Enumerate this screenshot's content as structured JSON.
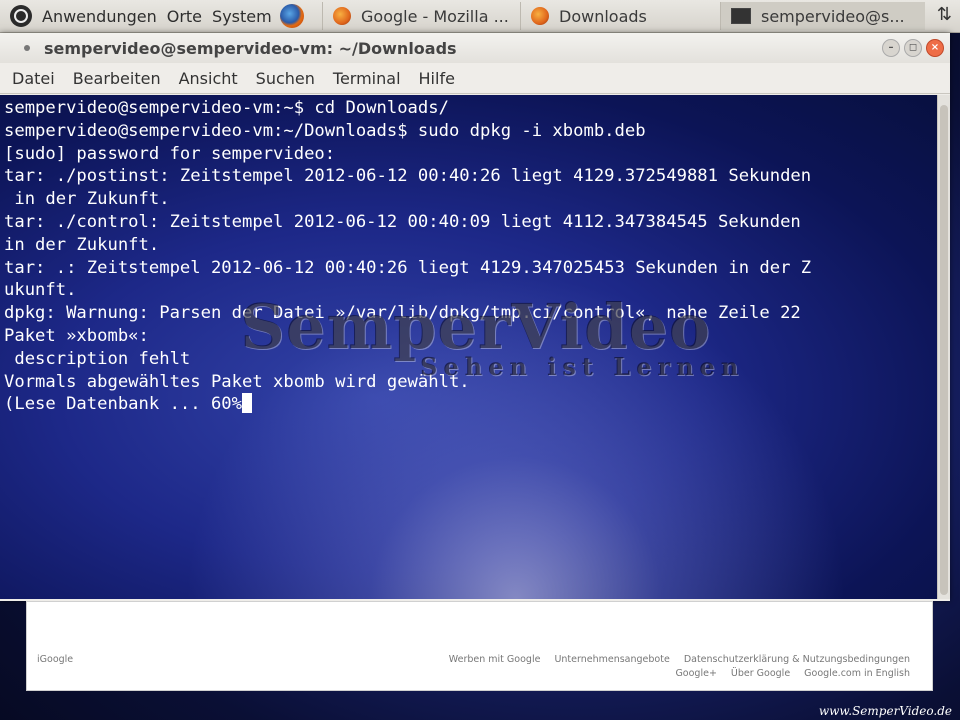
{
  "top_panel": {
    "menus": [
      "Anwendungen",
      "Orte",
      "System"
    ],
    "tasks": [
      "Google - Mozilla ...",
      "Downloads",
      "sempervideo@s..."
    ],
    "arrows_glyph": "⇅"
  },
  "window": {
    "title": "sempervideo@sempervideo-vm: ~/Downloads",
    "menubar": [
      "Datei",
      "Bearbeiten",
      "Ansicht",
      "Suchen",
      "Terminal",
      "Hilfe"
    ],
    "buttons": {
      "minimize": "–",
      "maximize": "◻",
      "close": "×"
    }
  },
  "terminal": {
    "lines": [
      "sempervideo@sempervideo-vm:~$ cd Downloads/",
      "sempervideo@sempervideo-vm:~/Downloads$ sudo dpkg -i xbomb.deb",
      "[sudo] password for sempervideo:",
      "tar: ./postinst: Zeitstempel 2012-06-12 00:40:26 liegt 4129.372549881 Sekunden",
      " in der Zukunft.",
      "tar: ./control: Zeitstempel 2012-06-12 00:40:09 liegt 4112.347384545 Sekunden",
      "in der Zukunft.",
      "tar: .: Zeitstempel 2012-06-12 00:40:26 liegt 4129.347025453 Sekunden in der Z",
      "ukunft.",
      "dpkg: Warnung: Parsen der Datei »/var/lib/dpkg/tmp.ci/control«, nahe Zeile 22",
      "Paket »xbomb«:",
      " description fehlt",
      "Vormals abgewähltes Paket xbomb wird gewählt.",
      "(Lese Datenbank ... 60%"
    ]
  },
  "watermark": {
    "brand": "SemperVideo",
    "tagline": "Sehen ist Lernen"
  },
  "browser": {
    "left_link": "iGoogle",
    "links_row1": [
      "Werben mit Google",
      "Unternehmensangebote",
      "Datenschutzerklärung & Nutzungsbedingungen"
    ],
    "links_row2": [
      "Google+",
      "Über Google",
      "Google.com in English"
    ]
  },
  "credit": "www.SemperVideo.de"
}
